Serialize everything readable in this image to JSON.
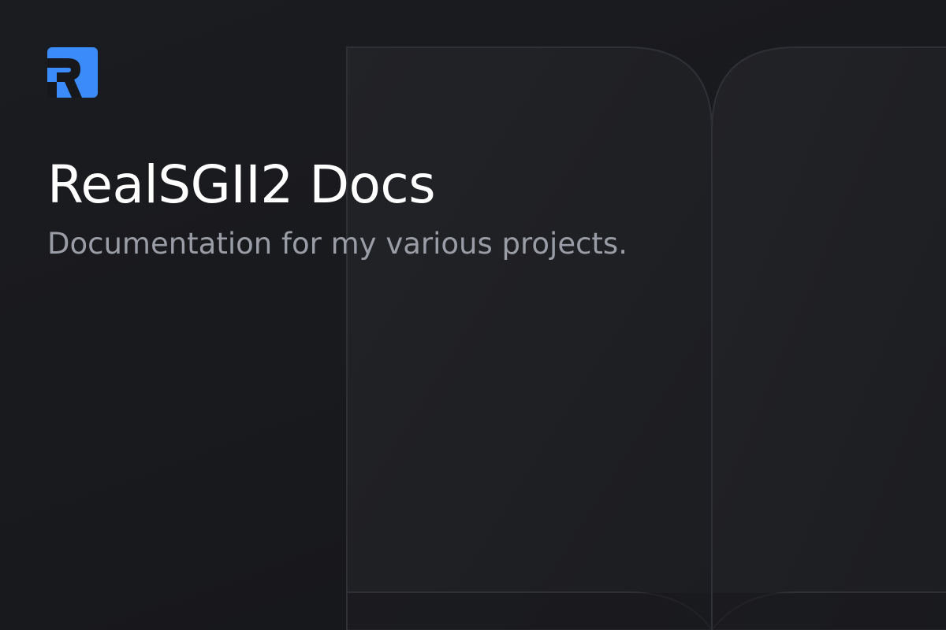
{
  "brand": {
    "logo_icon": "r-logo-icon",
    "logo_color": "#3b8bfa",
    "logo_letter_color": "#17181c"
  },
  "hero": {
    "title": "RealSGII2 Docs",
    "subtitle": "Documentation for my various projects."
  },
  "decoration": {
    "icon": "open-book-icon",
    "background": "#17181c",
    "page_fill": "#202125",
    "page_stroke": "#2f3035"
  }
}
